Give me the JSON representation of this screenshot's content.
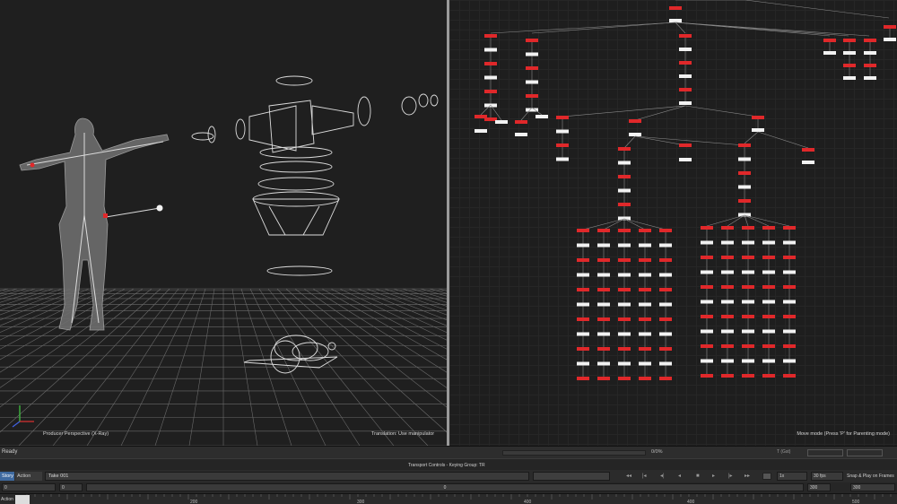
{
  "viewport": {
    "label_left": "Producer Perspective (X-Ray)",
    "label_right": "Translation: Use manipulator"
  },
  "schematic": {
    "label": "Move mode (Press 'P' for Parenting mode)"
  },
  "statusbar": {
    "status": "Ready",
    "progress_text": "0/0%",
    "right_text": "T (Gst)"
  },
  "transport": {
    "title": "Transport Controls  -  Keying Group: TR",
    "tab_story": "Story",
    "tab_action": "Action",
    "take": "Take 001",
    "speed": "1x",
    "fps": "30 fps",
    "snap": "Snap & Play on Frames",
    "range_start": "0",
    "range_current": "0",
    "range_mid": "0",
    "range_end": "300",
    "range_end2": "300"
  },
  "timeline": {
    "action_label": "Action",
    "ticks": [
      "200",
      "300",
      "400",
      "400",
      "500"
    ]
  },
  "colors": {
    "node_red": "#e0282a",
    "node_white": "#f2f2f2",
    "accent_blue": "#3f6aa0"
  },
  "icons": {
    "axis": "axis-gizmo-icon",
    "play": "play-icon",
    "record": "record-icon"
  }
}
